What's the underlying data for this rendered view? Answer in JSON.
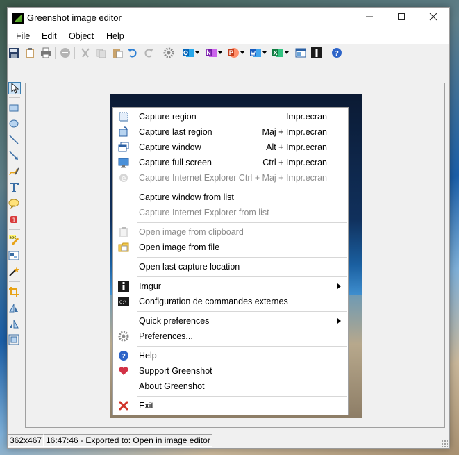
{
  "window": {
    "title": "Greenshot image editor"
  },
  "menubar": {
    "items": [
      "File",
      "Edit",
      "Object",
      "Help"
    ]
  },
  "toolbar": {
    "buttons": [
      "save-icon",
      "clipboard-icon",
      "print-icon",
      "delete-icon",
      "cut-icon",
      "copy-icon",
      "paste-icon",
      "undo-icon",
      "redo-icon",
      "settings-icon",
      "outlook-icon",
      "onenote-icon",
      "powerpoint-icon",
      "word-icon",
      "excel-icon",
      "window-icon",
      "imgur-icon",
      "help-icon"
    ]
  },
  "context_menu": {
    "items": [
      {
        "label": "Capture region",
        "shortcut": "Impr.ecran",
        "icon": "region-icon",
        "enabled": true
      },
      {
        "label": "Capture last region",
        "shortcut": "Maj + Impr.ecran",
        "icon": "last-region-icon",
        "enabled": true
      },
      {
        "label": "Capture window",
        "shortcut": "Alt + Impr.ecran",
        "icon": "window-capture-icon",
        "enabled": true
      },
      {
        "label": "Capture full screen",
        "shortcut": "Ctrl + Impr.ecran",
        "icon": "monitor-icon",
        "enabled": true
      },
      {
        "label": "Capture Internet Explorer",
        "shortcut": "Ctrl + Maj + Impr.ecran",
        "icon": "ie-icon",
        "enabled": false
      },
      {
        "label": "Capture window from list",
        "shortcut": "",
        "icon": "",
        "enabled": true
      },
      {
        "label": "Capture Internet Explorer from list",
        "shortcut": "",
        "icon": "",
        "enabled": false
      },
      {
        "label": "Open image from clipboard",
        "shortcut": "",
        "icon": "clipboard-icon",
        "enabled": false
      },
      {
        "label": "Open image from file",
        "shortcut": "",
        "icon": "folder-icon",
        "enabled": true
      },
      {
        "label": "Open last capture location",
        "shortcut": "",
        "icon": "",
        "enabled": true
      },
      {
        "label": "Imgur",
        "shortcut": "",
        "icon": "imgur-icon",
        "enabled": true,
        "submenu": true
      },
      {
        "label": "Configuration de commandes externes",
        "shortcut": "",
        "icon": "terminal-icon",
        "enabled": true
      },
      {
        "label": "Quick preferences",
        "shortcut": "",
        "icon": "",
        "enabled": true,
        "submenu": true
      },
      {
        "label": "Preferences...",
        "shortcut": "",
        "icon": "gear-icon",
        "enabled": true
      },
      {
        "label": "Help",
        "shortcut": "",
        "icon": "help-icon",
        "enabled": true
      },
      {
        "label": "Support Greenshot",
        "shortcut": "",
        "icon": "heart-icon",
        "enabled": true
      },
      {
        "label": "About Greenshot",
        "shortcut": "",
        "icon": "",
        "enabled": true
      },
      {
        "label": "Exit",
        "shortcut": "",
        "icon": "exit-icon",
        "enabled": true
      }
    ]
  },
  "statusbar": {
    "dimensions": "362x467",
    "message": "16:47:46 - Exported to: Open in image editor"
  },
  "colors": {
    "accent": "#3c7fb1",
    "disabled": "#8c8c8c",
    "help": "#2d64c8",
    "heart": "#d23246",
    "exit": "#d0352a"
  }
}
